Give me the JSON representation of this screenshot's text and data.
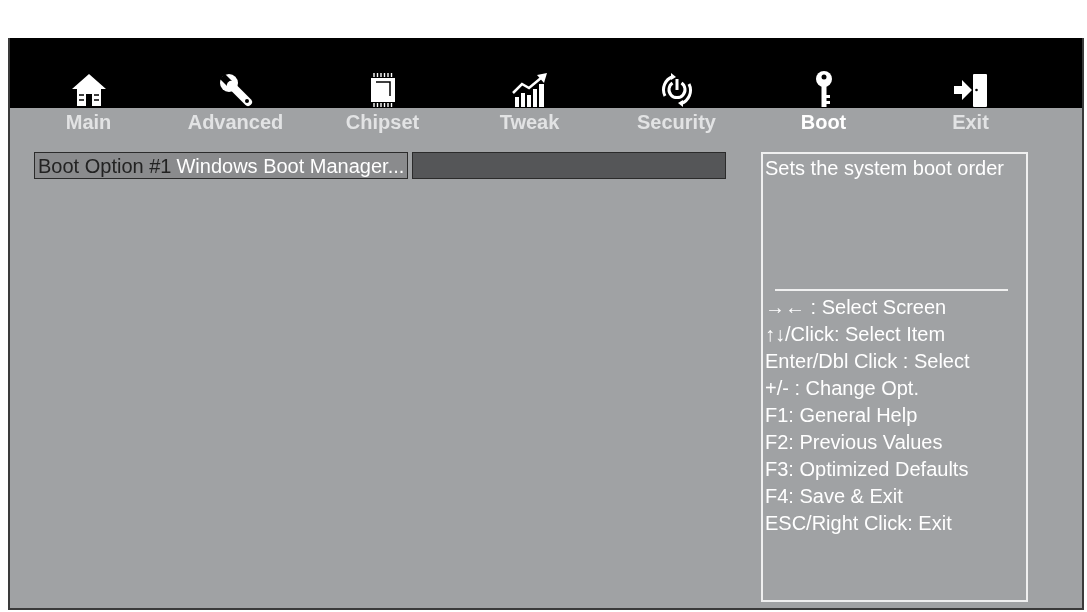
{
  "tabs": [
    {
      "label": "Main",
      "selected": false
    },
    {
      "label": "Advanced",
      "selected": false
    },
    {
      "label": "Chipset",
      "selected": false
    },
    {
      "label": "Tweak",
      "selected": false
    },
    {
      "label": "Security",
      "selected": false
    },
    {
      "label": "Boot",
      "selected": true
    },
    {
      "label": "Exit",
      "selected": false
    }
  ],
  "settings": [
    {
      "label": "Boot Option #1",
      "value": "Windows Boot Manager..."
    }
  ],
  "help_panel": {
    "description": "Sets the system boot order",
    "key_hints": [
      "→← : Select Screen",
      "↑↓/Click: Select Item",
      "Enter/Dbl Click : Select",
      "+/- : Change Opt.",
      "F1: General Help",
      "F2: Previous Values",
      "F3: Optimized Defaults",
      "F4: Save & Exit",
      "ESC/Right Click: Exit"
    ]
  }
}
